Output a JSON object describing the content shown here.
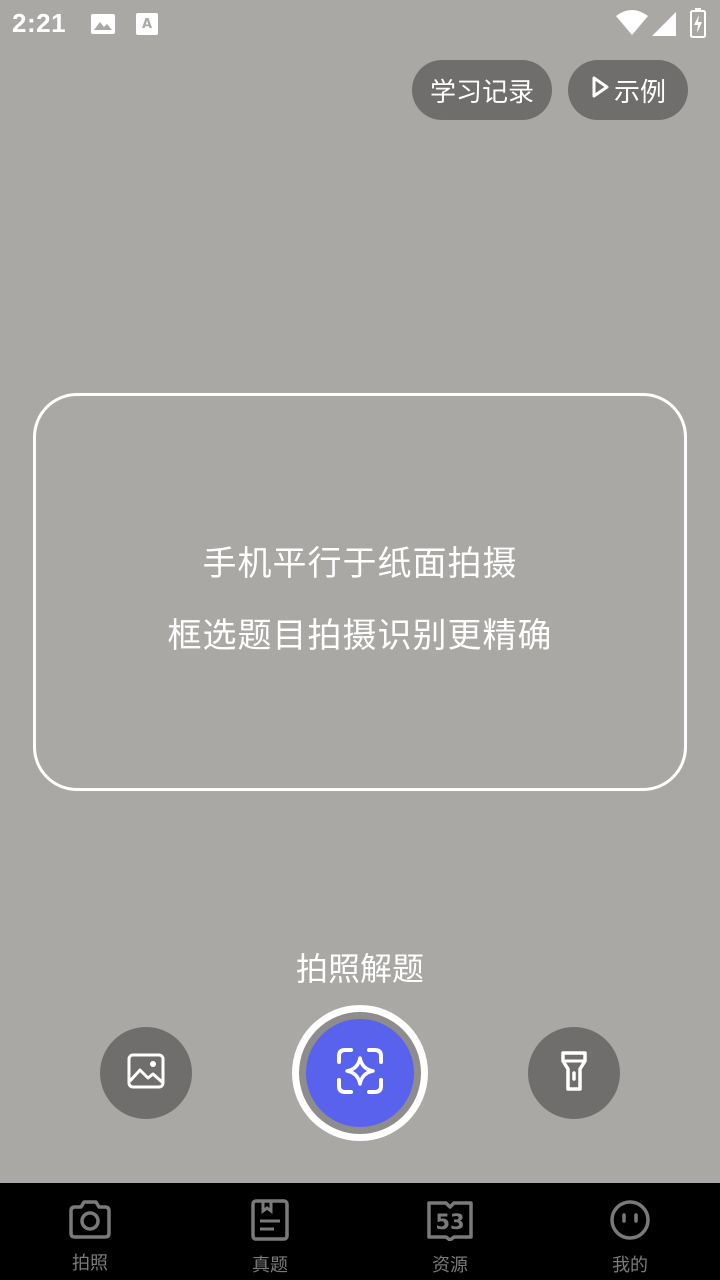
{
  "status_bar": {
    "time": "2:21",
    "left_icons": [
      "image-icon",
      "font-a-icon"
    ],
    "right_icons": [
      "wifi-icon",
      "signal-icon",
      "battery-icon"
    ]
  },
  "top_actions": {
    "history_label": "学习记录",
    "example_label": "示例"
  },
  "guide": {
    "line1": "手机平行于纸面拍摄",
    "line2": "框选题目拍摄识别更精确"
  },
  "camera": {
    "mode_label": "拍照解题",
    "left_button_icon": "gallery-icon",
    "shutter_icon": "scan-sparkle-icon",
    "right_button_icon": "flashlight-icon",
    "accent_color": "#5862ec"
  },
  "nav": {
    "items": [
      {
        "label": "拍照",
        "icon": "camera-icon"
      },
      {
        "label": "真题",
        "icon": "document-icon"
      },
      {
        "label": "资源",
        "icon": "book-53-icon",
        "icon_text": "53"
      },
      {
        "label": "我的",
        "icon": "face-icon"
      }
    ]
  }
}
